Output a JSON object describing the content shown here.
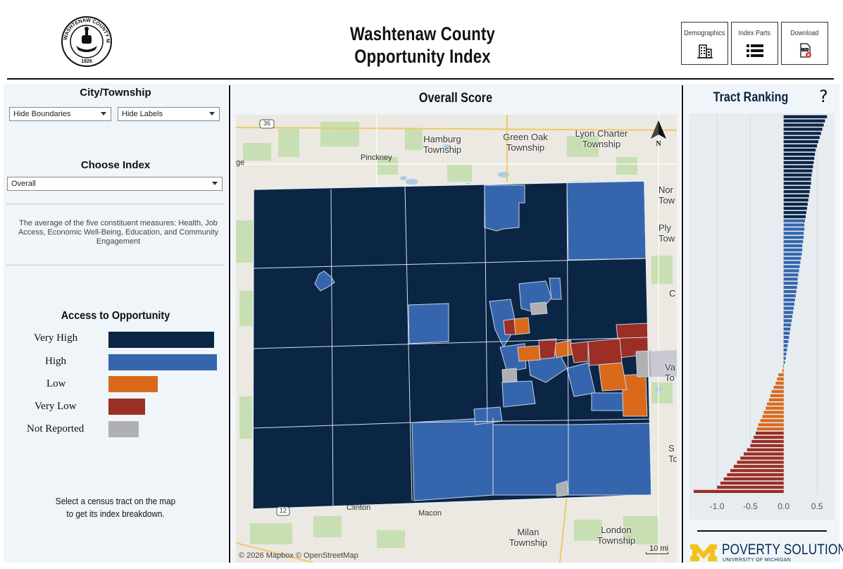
{
  "header": {
    "title_line1": "Washtenaw County",
    "title_line2": "Opportunity Index",
    "seal_text": "WASHTENAW COUNTY MICHIGAN",
    "seal_year": "1826",
    "buttons": [
      {
        "label": "Demographics",
        "icon": "building-icon"
      },
      {
        "label": "Index Parts",
        "icon": "list-icon"
      },
      {
        "label": "Download",
        "icon": "csv-file-icon"
      }
    ]
  },
  "left": {
    "city_township_title": "City/Township",
    "boundaries_select": "Hide Boundaries",
    "labels_select": "Hide Labels",
    "choose_index_title": "Choose Index",
    "index_select": "Overall",
    "index_description": "The average of the five constituent measures: Health, Job Access, Economic Well-Being, Education, and Community Engagement",
    "legend_title": "Access to Opportunity",
    "legend": [
      {
        "label": "Very High",
        "color": "#0b2545",
        "length": 0.95
      },
      {
        "label": "High",
        "color": "#3566ad",
        "length": 1.0
      },
      {
        "label": "Low",
        "color": "#d96a1c",
        "length": 0.45
      },
      {
        "label": "Very Low",
        "color": "#9b2e25",
        "length": 0.34
      },
      {
        "label": "Not Reported",
        "color": "#b0b0b2",
        "length": 0.28
      }
    ],
    "hint_line1": "Select a census tract on the map",
    "hint_line2": "to get its index breakdown."
  },
  "map": {
    "title": "Overall Score",
    "labels": {
      "hamburg": "Hamburg\nTownship",
      "green_oak": "Green Oak\nTownship",
      "lyon": "Lyon Charter\nTownship",
      "pinckney": "Pinckney",
      "clinton": "Clinton",
      "macon": "Macon",
      "milan": "Milan\nTownship",
      "london": "London\nTownship",
      "northville_partial": "Nor\nTow",
      "plymouth_partial": "Ply\nTow",
      "canton_partial": "C",
      "van_buren_partial": "Va\nTo",
      "sumpter_partial": "S\nTo",
      "route_36": "36",
      "route_12": "12",
      "edge_ge": "ge"
    },
    "compass": "N",
    "attribution": "© 2026 Mapbox  © OpenStreetMap",
    "scale": "10 mi"
  },
  "ranking": {
    "title": "Tract Ranking",
    "help": "?",
    "x_ticks": [
      "-1.0",
      "-0.5",
      "0.0",
      "0.5"
    ]
  },
  "chart_data": {
    "type": "bar",
    "orientation": "horizontal",
    "title": "Tract Ranking",
    "xlim": [
      -1.35,
      0.7
    ],
    "x_ticks": [
      -1.0,
      -0.5,
      0.0,
      0.5
    ],
    "values": [
      0.65,
      0.62,
      0.6,
      0.58,
      0.56,
      0.54,
      0.52,
      0.5,
      0.48,
      0.47,
      0.46,
      0.45,
      0.44,
      0.43,
      0.42,
      0.41,
      0.41,
      0.4,
      0.39,
      0.38,
      0.37,
      0.36,
      0.35,
      0.34,
      0.33,
      0.32,
      0.31,
      0.31,
      0.3,
      0.3,
      0.29,
      0.28,
      0.28,
      0.27,
      0.26,
      0.25,
      0.24,
      0.23,
      0.22,
      0.21,
      0.21,
      0.2,
      0.19,
      0.18,
      0.17,
      0.16,
      0.15,
      0.14,
      0.13,
      0.12,
      0.11,
      0.1,
      0.09,
      0.08,
      0.07,
      0.06,
      0.05,
      0.04,
      0.03,
      0.02,
      -0.01,
      -0.02,
      -0.08,
      -0.1,
      -0.12,
      -0.15,
      -0.18,
      -0.2,
      -0.22,
      -0.25,
      -0.27,
      -0.3,
      -0.32,
      -0.35,
      -0.38,
      -0.4,
      -0.42,
      -0.45,
      -0.48,
      -0.5,
      -0.55,
      -0.6,
      -0.65,
      -0.7,
      -0.75,
      -0.8,
      -0.85,
      -0.9,
      -0.95,
      -1.0,
      -1.35
    ],
    "category_colors": {
      "very_high": "#0b2545",
      "high": "#3566ad",
      "low": "#d96a1c",
      "very_low": "#9b2e25"
    },
    "thresholds": {
      "very_high_min": 0.33,
      "high_min": 0.0,
      "low_min": -0.4
    }
  },
  "footer": {
    "logo_m": "M",
    "brand": "POVERTY SOLUTIONS",
    "brand_sub": "UNIVERSITY OF MICHIGAN",
    "brand_color": "#0a2a54",
    "maize": "#f2c21a"
  }
}
